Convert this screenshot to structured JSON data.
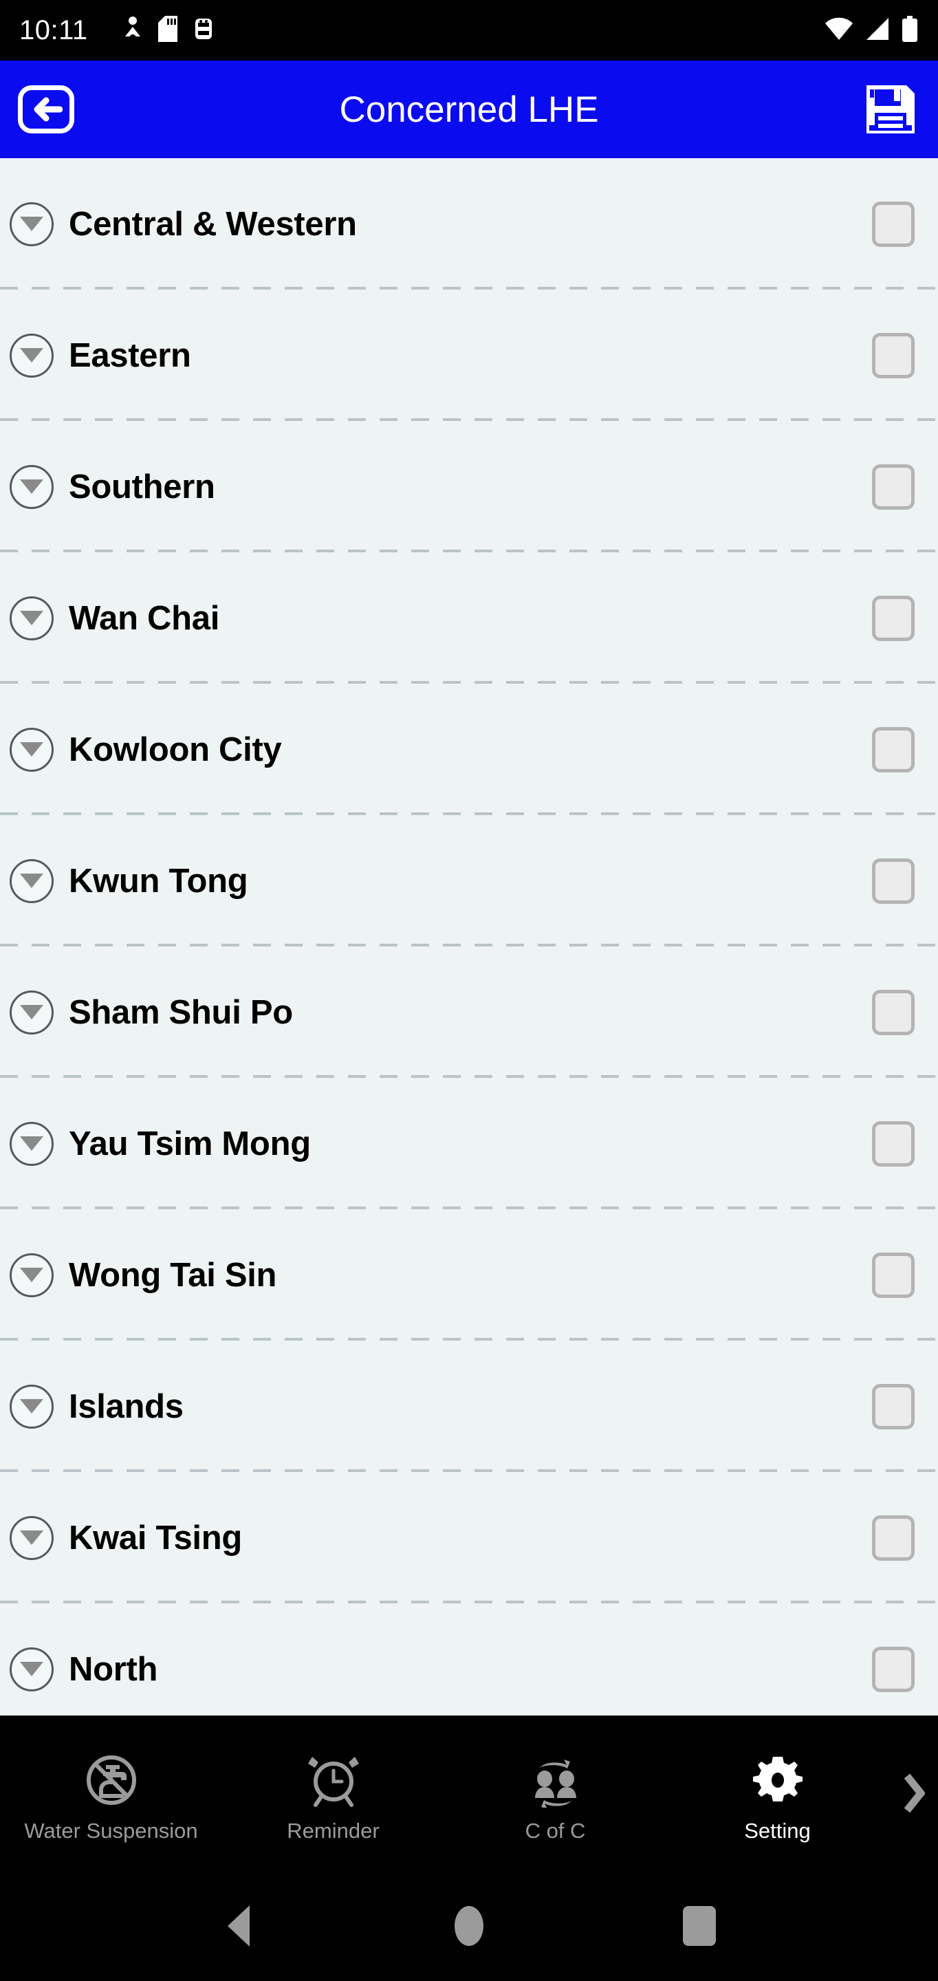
{
  "status_bar": {
    "time": "10:11",
    "left_icons": [
      "bluetooth-share-icon",
      "sd-card-icon",
      "usb-debug-icon"
    ],
    "right_icons": [
      "wifi-icon",
      "signal-icon",
      "battery-icon"
    ]
  },
  "app_bar": {
    "title": "Concerned LHE",
    "back_label": "Back",
    "save_label": "Save",
    "background_color": "#0b0bf0",
    "title_color": "#ffffff"
  },
  "list": {
    "background_color": "#eef4f4",
    "items": [
      {
        "label": "Central & Western",
        "checked": false
      },
      {
        "label": "Eastern",
        "checked": false
      },
      {
        "label": "Southern",
        "checked": false
      },
      {
        "label": "Wan Chai",
        "checked": false
      },
      {
        "label": "Kowloon City",
        "checked": false
      },
      {
        "label": "Kwun Tong",
        "checked": false
      },
      {
        "label": "Sham Shui Po",
        "checked": false
      },
      {
        "label": "Yau Tsim Mong",
        "checked": false
      },
      {
        "label": "Wong Tai Sin",
        "checked": false
      },
      {
        "label": "Islands",
        "checked": false
      },
      {
        "label": "Kwai Tsing",
        "checked": false
      },
      {
        "label": "North",
        "checked": false
      }
    ]
  },
  "tab_bar": {
    "background_color": "#000000",
    "active_color": "#ffffff",
    "inactive_color": "#9b9b9b",
    "more_label": "More tabs",
    "tabs": [
      {
        "label": "Water Suspension",
        "icon": "no-water-tap-icon",
        "active": false
      },
      {
        "label": "Reminder",
        "icon": "alarm-clock-icon",
        "active": false
      },
      {
        "label": "C of C",
        "icon": "change-of-occupancy-icon",
        "active": false
      },
      {
        "label": "Setting",
        "icon": "gear-icon",
        "active": true
      }
    ]
  },
  "system_nav": {
    "back_label": "Back",
    "home_label": "Home",
    "recents_label": "Recents"
  }
}
